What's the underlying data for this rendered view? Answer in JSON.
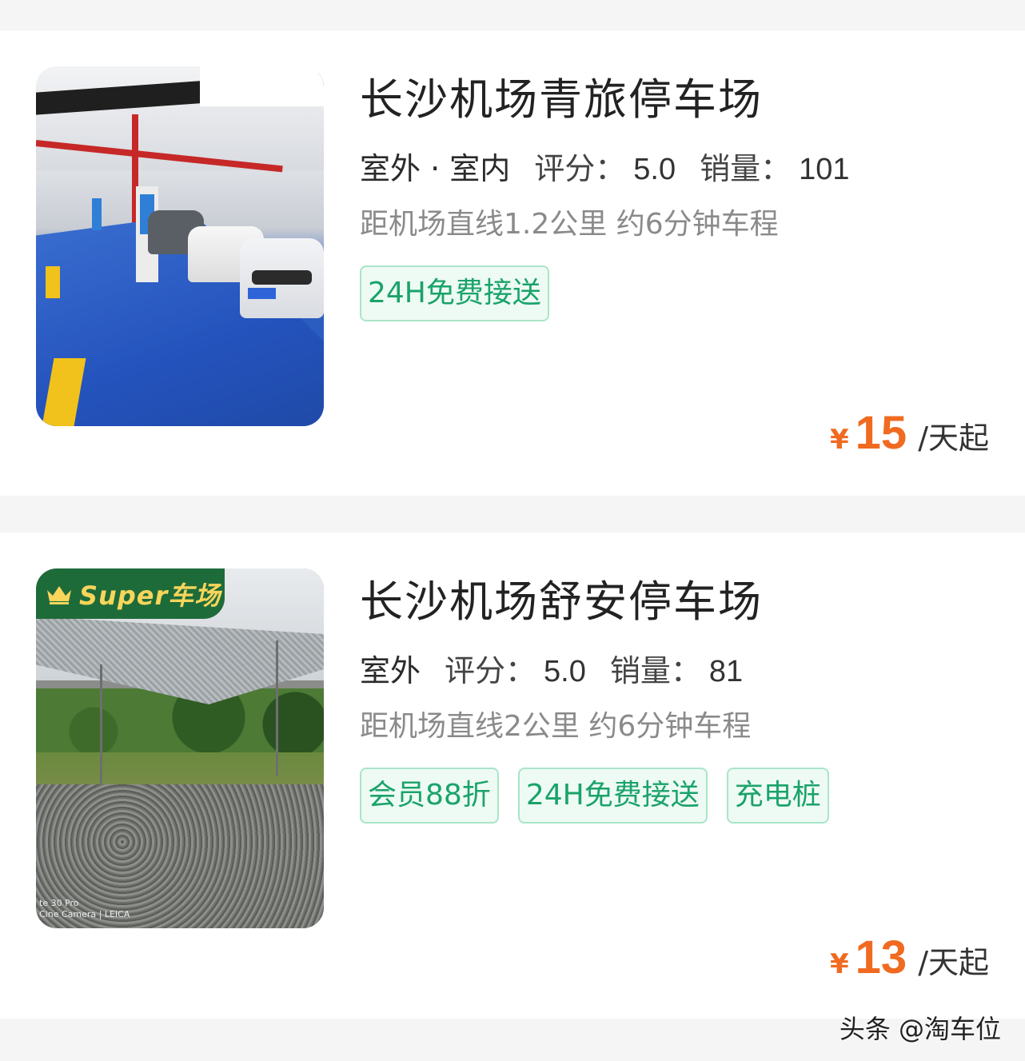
{
  "listings": [
    {
      "name": "长沙机场青旅停车场",
      "type": "室外 · 室内",
      "rating_label": "评分：",
      "rating": "5.0",
      "sales_label": "销量：",
      "sales": "101",
      "distance": "距机场直线1.2公里 约6分钟车程",
      "tags": [
        "24H免费接送"
      ],
      "currency": "¥",
      "price": "15",
      "price_unit": "/天起"
    },
    {
      "name": "长沙机场舒安停车场",
      "type": "室外",
      "rating_label": "评分：",
      "rating": "5.0",
      "sales_label": "销量：",
      "sales": "81",
      "distance": "距机场直线2公里 约6分钟车程",
      "badge": "Super车场",
      "photo_watermark": [
        "te 30 Pro",
        "Cine Camera | LEICA"
      ],
      "tags": [
        "会员88折",
        "24H免费接送",
        "充电桩"
      ],
      "currency": "¥",
      "price": "13",
      "price_unit": "/天起"
    }
  ],
  "watermark": "头条 @淘车位",
  "colors": {
    "price": "#f06a21",
    "tag_text": "#1aa36a",
    "tag_border": "#a9e5c9",
    "badge_bg": "#1e6b3a",
    "badge_text": "#f8d55b"
  }
}
